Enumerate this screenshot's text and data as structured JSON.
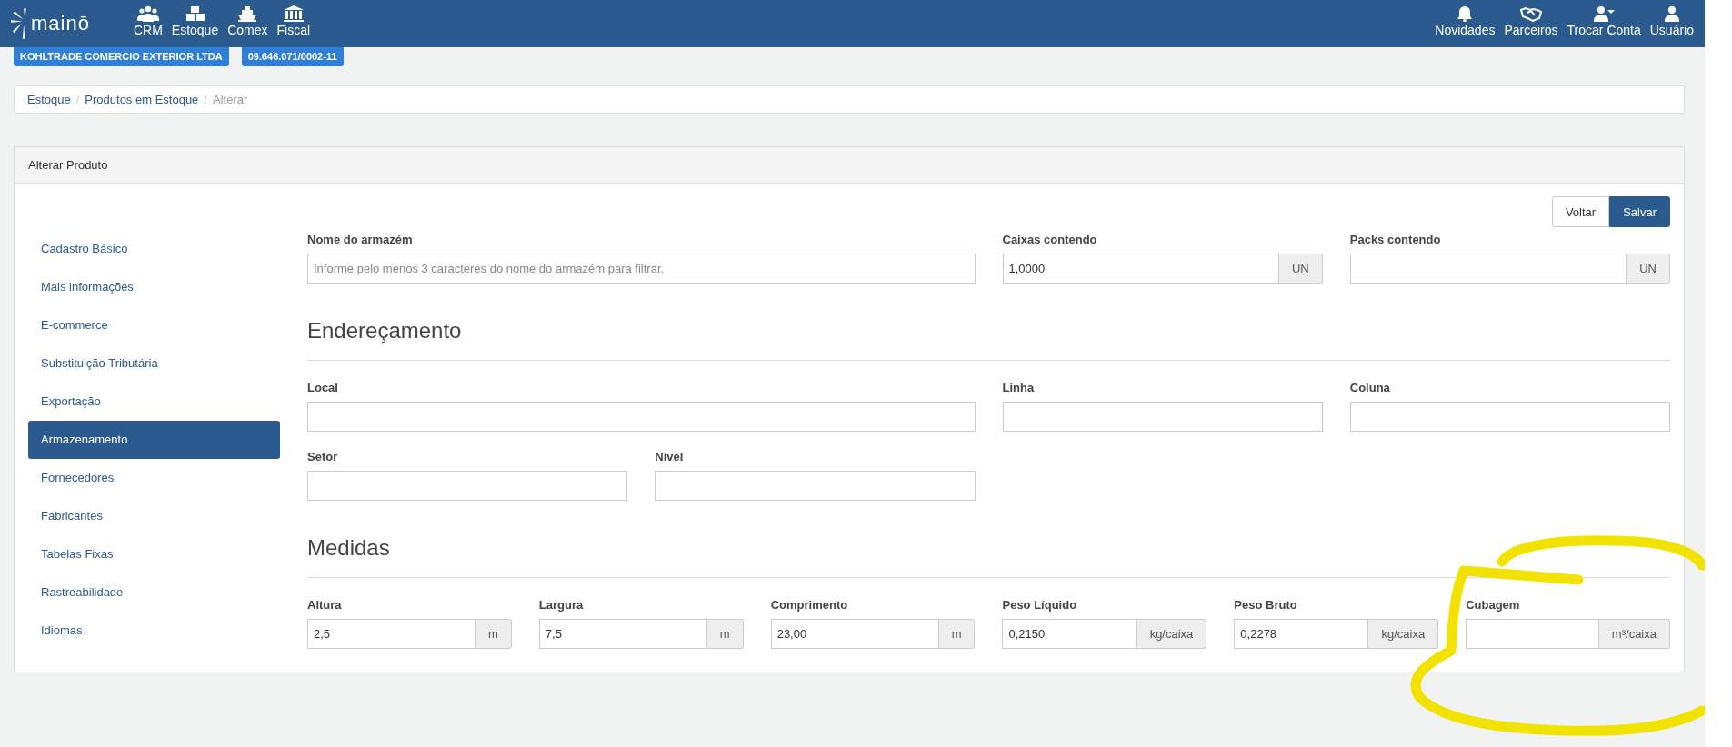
{
  "header": {
    "logo": "mainō",
    "nav": [
      {
        "label": "CRM"
      },
      {
        "label": "Estoque"
      },
      {
        "label": "Comex"
      },
      {
        "label": "Fiscal"
      }
    ],
    "right_menu": [
      {
        "label": "Novidades"
      },
      {
        "label": "Parceiros"
      },
      {
        "label": "Trocar Conta"
      },
      {
        "label": "Usuário"
      }
    ]
  },
  "company_badges": [
    "KOHLTRADE COMERCIO EXTERIOR LTDA",
    "09.646.071/0002-11"
  ],
  "breadcrumb": {
    "separator": "/",
    "items": [
      {
        "label": "Estoque",
        "current": false
      },
      {
        "label": "Produtos em Estoque",
        "current": false
      },
      {
        "label": "Alterar",
        "current": true
      }
    ]
  },
  "panel": {
    "title": "Alterar Produto"
  },
  "sidebar": {
    "items": [
      {
        "label": "Cadastro Básico",
        "selected": false
      },
      {
        "label": "Mais informações",
        "selected": false
      },
      {
        "label": "E-commerce",
        "selected": false
      },
      {
        "label": "Substituição Tributária",
        "selected": false
      },
      {
        "label": "Exportação",
        "selected": false
      },
      {
        "label": "Armazenamento",
        "selected": true
      },
      {
        "label": "Fornecedores",
        "selected": false
      },
      {
        "label": "Fabricantes",
        "selected": false
      },
      {
        "label": "Tabelas Fixas",
        "selected": false
      },
      {
        "label": "Rastreabilidade",
        "selected": false
      },
      {
        "label": "Idiomas",
        "selected": false
      }
    ]
  },
  "actions": [
    {
      "label": "Voltar",
      "primary": false
    },
    {
      "label": "Salvar",
      "primary": true
    }
  ],
  "top_fields": [
    {
      "label": "Nome do armazém",
      "placeholder": "Informe pelo menos 3 caracteres do nome do armazém para filtrar."
    },
    {
      "label": "Caixas contendo",
      "value": "1,0000",
      "unit": "UN"
    },
    {
      "label": "Packs contendo",
      "unit": "UN"
    }
  ],
  "sections": [
    {
      "title": "Endereçamento",
      "rows": [
        [
          {
            "label": "Local"
          },
          {
            "label": "Linha"
          },
          {
            "label": "Coluna"
          }
        ],
        [
          {
            "label": "Setor"
          },
          {
            "label": "Nível"
          }
        ]
      ]
    },
    {
      "title": "Medidas",
      "rows": [
        [
          {
            "label": "Altura",
            "value": "2,5",
            "unit": "m"
          },
          {
            "label": "Largura",
            "value": "7,5",
            "unit": "m"
          },
          {
            "label": "Comprimento",
            "value": "23,00",
            "unit": "m"
          },
          {
            "label": "Peso Líquido",
            "value": "0,2150",
            "unit": "kg/caixa"
          },
          {
            "label": "Peso Bruto",
            "value": "0,2278",
            "unit": "kg/caixa"
          },
          {
            "label": "Cubagem",
            "unit": "m³/caixa"
          }
        ]
      ]
    }
  ]
}
